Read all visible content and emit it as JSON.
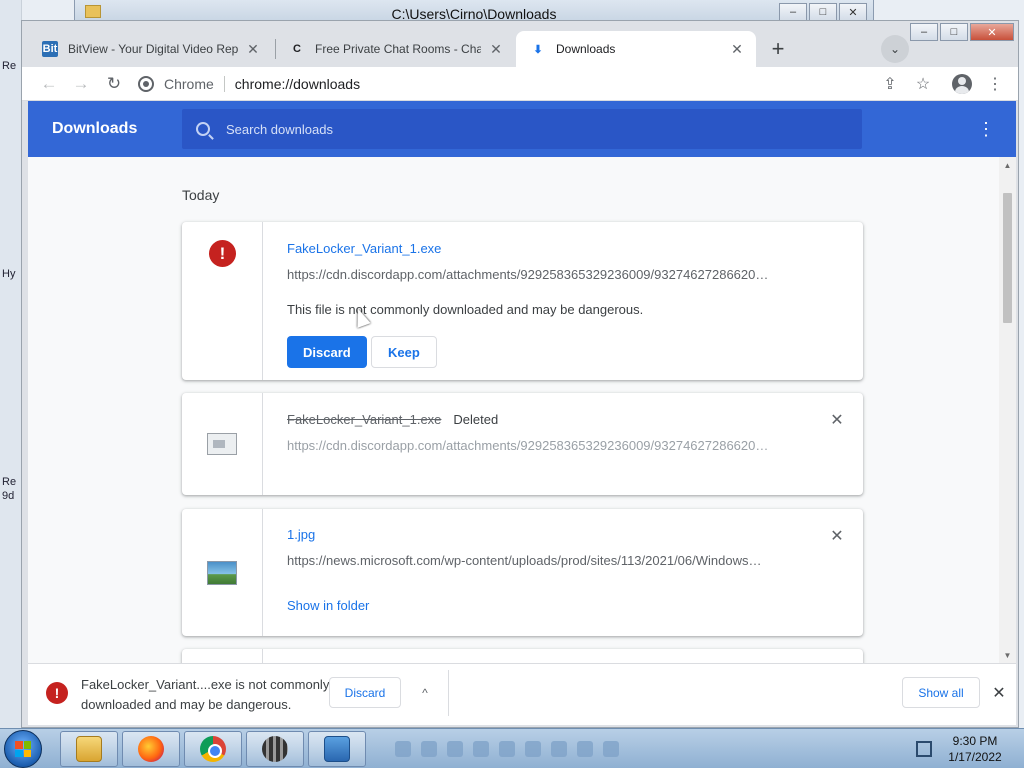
{
  "explorer": {
    "title": "C:\\Users\\Cirno\\Downloads"
  },
  "desktop": {
    "labels": [
      "Re",
      "Hy",
      "Re",
      "9d"
    ]
  },
  "window_controls": {
    "minimize": "–",
    "maximize": "□",
    "close": "✕"
  },
  "tabs": [
    {
      "label": "BitView - Your Digital Video Rep",
      "favicon": "Bit",
      "icon": "bitview-favicon"
    },
    {
      "label": "Free Private Chat Rooms - Chatzy",
      "favicon": "C",
      "icon": "chatzy-favicon"
    },
    {
      "label": "Downloads",
      "favicon": "⬇",
      "icon": "download-favicon",
      "active": true
    }
  ],
  "tab_close": "✕",
  "new_tab": "+",
  "tab_search": "⌄",
  "toolbar": {
    "back": "←",
    "forward": "→",
    "reload": "↻",
    "chip": "Chrome",
    "url": "chrome://downloads",
    "share": "⇪",
    "bookmark": "☆",
    "menu": "⋮"
  },
  "downloads_page": {
    "title": "Downloads",
    "search_placeholder": "Search downloads",
    "more": "⋮",
    "date_header": "Today",
    "items": [
      {
        "name": "FakeLocker_Variant_1.exe",
        "url": "https://cdn.discordapp.com/attachments/929258365329236009/93274627286620…",
        "warning": "This file is not commonly downloaded and may be dangerous.",
        "discard_label": "Discard",
        "keep_label": "Keep",
        "icon": "danger-icon",
        "icon_glyph": "!"
      },
      {
        "name": "FakeLocker_Variant_1.exe",
        "status": "Deleted",
        "url": "https://cdn.discordapp.com/attachments/929258365329236009/93274627286620…",
        "icon": "file-icon"
      },
      {
        "name": "1.jpg",
        "url": "https://news.microsoft.com/wp-content/uploads/prod/sites/113/2021/06/Windows…",
        "action": "Show in folder",
        "icon": "image-file-icon"
      }
    ],
    "item_close": "✕"
  },
  "scrollbar": {
    "up": "▲",
    "down": "▼"
  },
  "shelf": {
    "icon_glyph": "!",
    "message": "FakeLocker_Variant....exe is not commonly downloaded and may be dangerous.",
    "discard_label": "Discard",
    "chevron": "^",
    "show_all_label": "Show all",
    "close": "✕"
  },
  "taskbar": {
    "clock_time": "9:30 PM",
    "clock_date": "1/17/2022",
    "apps": [
      "explorer",
      "firefox",
      "chrome",
      "media-player",
      "control-panel"
    ]
  },
  "colors": {
    "header_blue": "#3367d6",
    "link_blue": "#1a73e8",
    "danger_red": "#c5221f"
  }
}
